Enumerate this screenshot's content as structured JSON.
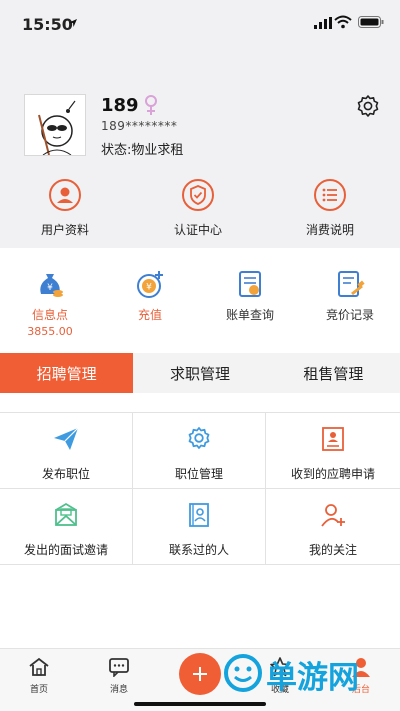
{
  "status_bar": {
    "time": "15:50"
  },
  "profile": {
    "name": "189",
    "phone": "189********",
    "status": "状态:物业求租"
  },
  "quick_actions": [
    {
      "label": "用户资料",
      "icon": "user-profile-icon"
    },
    {
      "label": "认证中心",
      "icon": "shield-check-icon"
    },
    {
      "label": "消费说明",
      "icon": "list-bubble-icon"
    }
  ],
  "wallet": [
    {
      "label": "信息点",
      "value": "3855.00",
      "icon": "money-bag-icon"
    },
    {
      "label": "充值",
      "icon": "recharge-icon"
    },
    {
      "label": "账单查询",
      "icon": "bill-icon"
    },
    {
      "label": "竞价记录",
      "icon": "bid-record-icon"
    }
  ],
  "tabs": [
    {
      "label": "招聘管理",
      "active": true
    },
    {
      "label": "求职管理",
      "active": false
    },
    {
      "label": "租售管理",
      "active": false
    }
  ],
  "grid": [
    {
      "label": "发布职位",
      "icon": "paper-plane-icon"
    },
    {
      "label": "职位管理",
      "icon": "gear-icon"
    },
    {
      "label": "收到的应聘申请",
      "icon": "resume-icon"
    },
    {
      "label": "发出的面试邀请",
      "icon": "envelope-icon"
    },
    {
      "label": "联系过的人",
      "icon": "contact-book-icon"
    },
    {
      "label": "我的关注",
      "icon": "user-plus-icon"
    }
  ],
  "bottom_nav": [
    {
      "label": "首页",
      "icon": "home-icon"
    },
    {
      "label": "消息",
      "icon": "message-icon"
    },
    {
      "label": "收藏",
      "icon": "star-icon"
    },
    {
      "label": "后台",
      "icon": "person-icon"
    }
  ],
  "watermark": "单游网",
  "colors": {
    "accent": "#ef5e35",
    "profile_bg": "#f1f1f3",
    "watermark": "#14a3dd"
  }
}
